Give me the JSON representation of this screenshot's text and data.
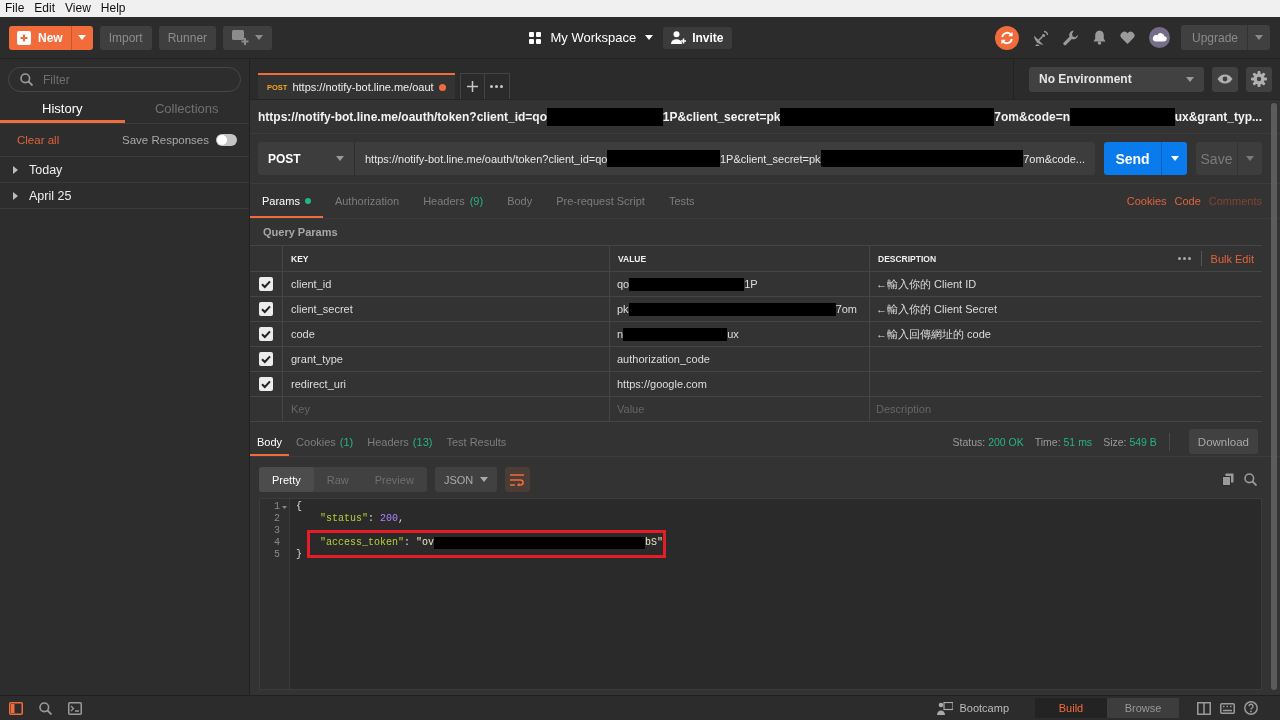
{
  "menu_bar": [
    "File",
    "Edit",
    "View",
    "Help"
  ],
  "header": {
    "new_button": "New",
    "buttons": [
      "Import",
      "Runner"
    ],
    "workspace": "My Workspace",
    "invite_button": "Invite",
    "upgrade_button": "Upgrade"
  },
  "sidebar": {
    "filter": {
      "placeholder": "Filter"
    },
    "tabs": [
      {
        "label": "History",
        "selected": true
      },
      {
        "label": "Collections",
        "selected": false
      }
    ],
    "clear_all": "Clear all",
    "save_responses": {
      "label": "Save Responses",
      "on": false
    },
    "groups": [
      {
        "label": "Today",
        "expanded": false
      },
      {
        "label": "April 25",
        "expanded": false
      }
    ]
  },
  "open_tabs": [
    {
      "method": "POST",
      "title": "https://notify-bot.line.me/oaut",
      "unsaved": true,
      "selected": true
    }
  ],
  "environment_dropdown": {
    "value": "No Environment"
  },
  "request": {
    "title": [
      {
        "kind": "text",
        "text": "https://notify-bot.line.me/oauth/token?client_id=qo"
      },
      {
        "kind": "redacted"
      },
      {
        "kind": "text",
        "text": "1P&client_secret=pk"
      },
      {
        "kind": "redacted"
      },
      {
        "kind": "text",
        "text": "7om&code=n"
      },
      {
        "kind": "redacted"
      },
      {
        "kind": "text",
        "text": "ux&grant_typ..."
      }
    ],
    "method": "POST",
    "url": [
      {
        "kind": "text",
        "text": "https://notify-bot.line.me/oauth/token?client_id=qo"
      },
      {
        "kind": "redacted"
      },
      {
        "kind": "text",
        "text": "1P&client_secret=pk"
      },
      {
        "kind": "redacted"
      },
      {
        "kind": "text",
        "text": "7om&code..."
      }
    ],
    "send_button": "Send",
    "save_button": "Save",
    "tabs": [
      {
        "label": "Params",
        "selected": true,
        "indicator": true
      },
      {
        "label": "Authorization",
        "selected": false,
        "indicator": false
      },
      {
        "label": "Headers",
        "count": "(9)",
        "selected": false,
        "indicator": false
      },
      {
        "label": "Body",
        "selected": false,
        "indicator": false
      },
      {
        "label": "Pre-request Script",
        "selected": false,
        "indicator": false
      },
      {
        "label": "Tests",
        "selected": false,
        "indicator": false
      }
    ],
    "links": [
      {
        "label": "Cookies",
        "disabled": false
      },
      {
        "label": "Code",
        "disabled": false
      },
      {
        "label": "Comments",
        "disabled": true
      }
    ],
    "query_params": {
      "title": "Query Params",
      "columns": [
        "KEY",
        "VALUE",
        "DESCRIPTION"
      ],
      "bulk_edit": "Bulk Edit",
      "rows": [
        {
          "checked": true,
          "key": "client_id",
          "value": [
            {
              "kind": "text",
              "text": "qo"
            },
            {
              "kind": "redacted"
            },
            {
              "kind": "text",
              "text": "1P"
            }
          ],
          "description": "←輸入你的 Client ID"
        },
        {
          "checked": true,
          "key": "client_secret",
          "value": [
            {
              "kind": "text",
              "text": "pk"
            },
            {
              "kind": "redacted"
            },
            {
              "kind": "text",
              "text": "7om"
            }
          ],
          "description": "←輸入你的 Client Secret"
        },
        {
          "checked": true,
          "key": "code",
          "value": [
            {
              "kind": "text",
              "text": "n"
            },
            {
              "kind": "redacted"
            },
            {
              "kind": "text",
              "text": "ux"
            }
          ],
          "description": "←輸入回傳網址的 code"
        },
        {
          "checked": true,
          "key": "grant_type",
          "value": [
            {
              "kind": "text",
              "text": "authorization_code"
            }
          ]
        },
        {
          "checked": true,
          "key": "redirect_uri",
          "value": [
            {
              "kind": "text",
              "text": "https://google.com"
            }
          ]
        }
      ],
      "new_row": {
        "key": {
          "placeholder": "Key"
        },
        "value": {
          "placeholder": "Value"
        },
        "description": {
          "placeholder": "Description"
        }
      }
    }
  },
  "response": {
    "tabs": [
      {
        "label": "Body",
        "selected": true
      },
      {
        "label": "Cookies",
        "count": "(1)",
        "selected": false
      },
      {
        "label": "Headers",
        "count": "(13)",
        "selected": false
      },
      {
        "label": "Test Results",
        "selected": false
      }
    ],
    "stats": [
      {
        "label": "Status:",
        "value": "200 OK"
      },
      {
        "label": "Time:",
        "value": "51 ms"
      },
      {
        "label": "Size:",
        "value": "549 B"
      }
    ],
    "download_button": "Download",
    "view_modes": [
      {
        "label": "Pretty",
        "selected": true
      },
      {
        "label": "Raw",
        "selected": false
      },
      {
        "label": "Preview",
        "selected": false
      }
    ],
    "format": "JSON",
    "lines": [
      {
        "number": "1",
        "foldable": true,
        "highlighted": false,
        "indented": false,
        "tokens": [
          {
            "kind": "punctuation",
            "text": "{"
          }
        ]
      },
      {
        "number": "2",
        "foldable": false,
        "highlighted": false,
        "indented": true,
        "tokens": [
          {
            "kind": "key",
            "text": "\"status\""
          },
          {
            "kind": "punctuation",
            "text": ": "
          },
          {
            "kind": "number",
            "text": "200"
          },
          {
            "kind": "punctuation",
            "text": ","
          }
        ]
      },
      {
        "number": "3",
        "foldable": false,
        "highlighted": false
      },
      {
        "number": "4",
        "foldable": false,
        "highlighted": true,
        "indented": true,
        "tokens": [
          {
            "kind": "key",
            "text": "\"access_token\""
          },
          {
            "kind": "punctuation",
            "text": ": "
          },
          {
            "kind": "string",
            "text": "\"ov"
          },
          {
            "kind": "redacted"
          },
          {
            "kind": "string",
            "text": "bS\""
          }
        ]
      },
      {
        "number": "5",
        "foldable": false,
        "highlighted": false,
        "indented": false,
        "tokens": [
          {
            "kind": "punctuation",
            "text": "}"
          }
        ]
      }
    ]
  },
  "status_bar": {
    "bootcamp": "Bootcamp",
    "modes": [
      {
        "label": "Build",
        "selected": true
      },
      {
        "label": "Browse",
        "selected": false
      }
    ]
  }
}
